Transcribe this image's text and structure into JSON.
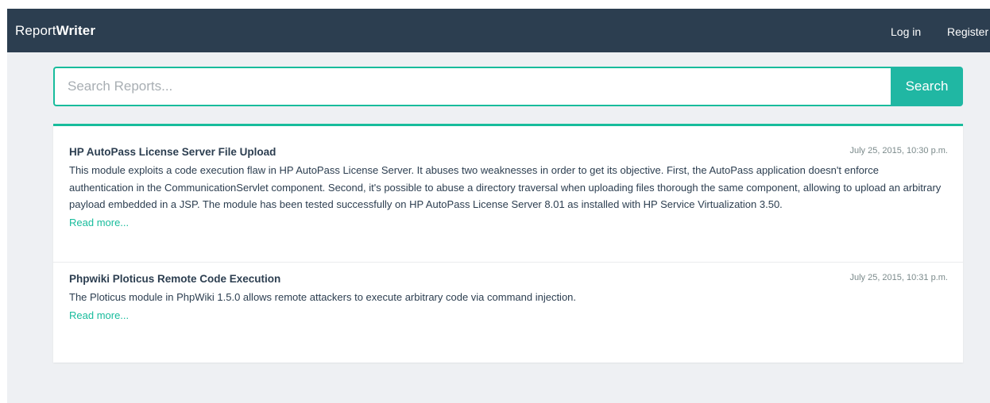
{
  "brand": {
    "name_regular": "Report",
    "name_bold": "Writer"
  },
  "nav": {
    "login_label": "Log in",
    "register_label": "Register"
  },
  "search": {
    "placeholder": "Search Reports...",
    "value": "",
    "button_label": "Search"
  },
  "reports": [
    {
      "title": "HP AutoPass License Server File Upload",
      "date": "July 25, 2015, 10:30 p.m.",
      "description": "This module exploits a code execution flaw in HP AutoPass License Server. It abuses two weaknesses in order to get its objective. First, the AutoPass application doesn't enforce authentication in the CommunicationServlet component. Second, it's possible to abuse a directory traversal when uploading files thorough the same component, allowing to upload an arbitrary payload embedded in a JSP. The module has been tested successfully on HP AutoPass License Server 8.01 as installed with HP Service Virtualization 3.50.",
      "read_more": "Read more..."
    },
    {
      "title": "Phpwiki Ploticus Remote Code Execution",
      "date": "July 25, 2015, 10:31 p.m.",
      "description": "The Ploticus module in PhpWiki 1.5.0 allows remote attackers to execute arbitrary code via command injection.",
      "read_more": "Read more..."
    }
  ],
  "colors": {
    "navbar": "#2c3e50",
    "accent": "#18bc9c",
    "search_button": "#20b7a3",
    "page_background": "#eef0f3"
  }
}
